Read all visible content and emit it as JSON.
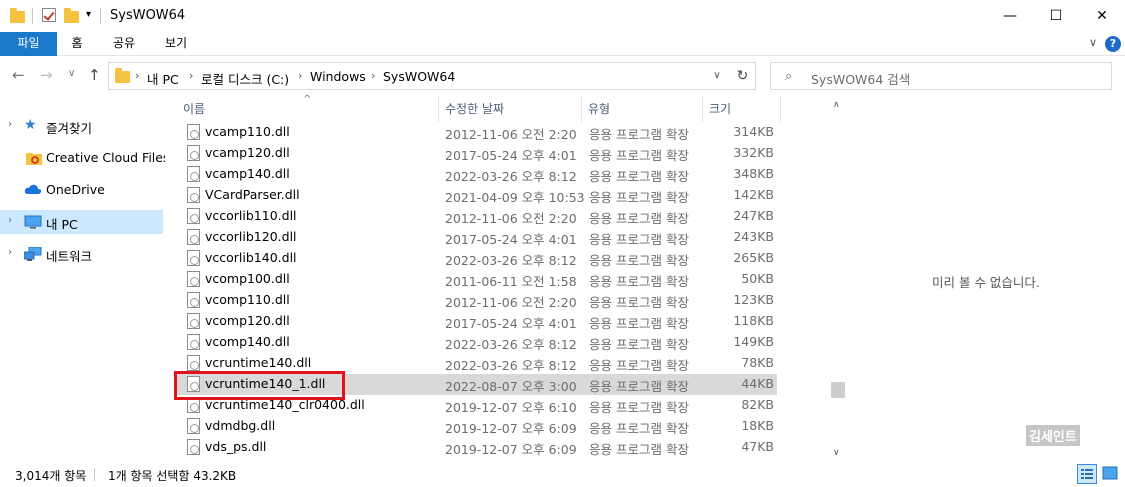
{
  "window": {
    "title": "SysWOW64",
    "minimize_glyph": "—",
    "maximize_glyph": "☐",
    "close_glyph": "✕",
    "quick_access_dropdown": "▾"
  },
  "ribbon": {
    "tabs": [
      {
        "label": "파일",
        "active": true
      },
      {
        "label": "홈"
      },
      {
        "label": "공유"
      },
      {
        "label": "보기"
      }
    ],
    "help_glyph": "?",
    "collapse_glyph": "∨"
  },
  "address": {
    "back_glyph": "←",
    "forward_glyph": "→",
    "recent_glyph": "∨",
    "up_glyph": "↑",
    "breadcrumbs": [
      "내 PC",
      "로컬 디스크 (C:)",
      "Windows",
      "SysWOW64"
    ],
    "separator": "›",
    "dropdown_glyph": "∨",
    "refresh_glyph": "↻"
  },
  "search": {
    "placeholder": "SysWOW64 검색",
    "icon": "search-icon"
  },
  "nav": {
    "expand_glyph": "›",
    "items": [
      {
        "label": "즐겨찾기",
        "icon": "star-icon",
        "expandable": true
      },
      {
        "label": "Creative Cloud Files",
        "icon": "creative-cloud-folder-icon",
        "expandable": false
      },
      {
        "label": "OneDrive",
        "icon": "onedrive-cloud-icon",
        "expandable": false
      },
      {
        "label": "내 PC",
        "icon": "computer-icon",
        "expandable": true,
        "selected": true
      },
      {
        "label": "네트워크",
        "icon": "network-icon",
        "expandable": true
      }
    ]
  },
  "list": {
    "columns": [
      "이름",
      "수정한 날짜",
      "유형",
      "크기"
    ],
    "sort_glyph": "^",
    "rows": [
      {
        "name": "vcamp110.dll",
        "date": "2012-11-06 오전 2:20",
        "type": "응용 프로그램 확장",
        "size": "314KB"
      },
      {
        "name": "vcamp120.dll",
        "date": "2017-05-24 오후 4:01",
        "type": "응용 프로그램 확장",
        "size": "332KB"
      },
      {
        "name": "vcamp140.dll",
        "date": "2022-03-26 오후 8:12",
        "type": "응용 프로그램 확장",
        "size": "348KB"
      },
      {
        "name": "VCardParser.dll",
        "date": "2021-04-09 오후 10:53",
        "type": "응용 프로그램 확장",
        "size": "142KB"
      },
      {
        "name": "vccorlib110.dll",
        "date": "2012-11-06 오전 2:20",
        "type": "응용 프로그램 확장",
        "size": "247KB"
      },
      {
        "name": "vccorlib120.dll",
        "date": "2017-05-24 오후 4:01",
        "type": "응용 프로그램 확장",
        "size": "243KB"
      },
      {
        "name": "vccorlib140.dll",
        "date": "2022-03-26 오후 8:12",
        "type": "응용 프로그램 확장",
        "size": "265KB"
      },
      {
        "name": "vcomp100.dll",
        "date": "2011-06-11 오전 1:58",
        "type": "응용 프로그램 확장",
        "size": "50KB"
      },
      {
        "name": "vcomp110.dll",
        "date": "2012-11-06 오전 2:20",
        "type": "응용 프로그램 확장",
        "size": "123KB"
      },
      {
        "name": "vcomp120.dll",
        "date": "2017-05-24 오후 4:01",
        "type": "응용 프로그램 확장",
        "size": "118KB"
      },
      {
        "name": "vcomp140.dll",
        "date": "2022-03-26 오후 8:12",
        "type": "응용 프로그램 확장",
        "size": "149KB"
      },
      {
        "name": "vcruntime140.dll",
        "date": "2022-03-26 오후 8:12",
        "type": "응용 프로그램 확장",
        "size": "78KB"
      },
      {
        "name": "vcruntime140_1.dll",
        "date": "2022-08-07 오후 3:00",
        "type": "응용 프로그램 확장",
        "size": "44KB",
        "selected": true
      },
      {
        "name": "vcruntime140_clr0400.dll",
        "date": "2019-12-07 오후 6:10",
        "type": "응용 프로그램 확장",
        "size": "82KB"
      },
      {
        "name": "vdmdbg.dll",
        "date": "2019-12-07 오후 6:09",
        "type": "응용 프로그램 확장",
        "size": "18KB"
      },
      {
        "name": "vds_ps.dll",
        "date": "2019-12-07 오후 6:09",
        "type": "응용 프로그램 확장",
        "size": "47KB"
      }
    ]
  },
  "scrollbar": {
    "up_glyph": "∧",
    "down_glyph": "∨",
    "position_fraction": 0.82
  },
  "preview": {
    "message": "미리 볼 수 없습니다.",
    "watermark": "김세인트"
  },
  "status": {
    "item_count": "3,014개 항목",
    "selection": "1개 항목 선택함 43.2KB"
  },
  "colors": {
    "file_tab": "#1979ca",
    "nav_selected": "#cce8ff",
    "row_selected": "#d9d9d9",
    "highlight_box": "#e0121b"
  }
}
